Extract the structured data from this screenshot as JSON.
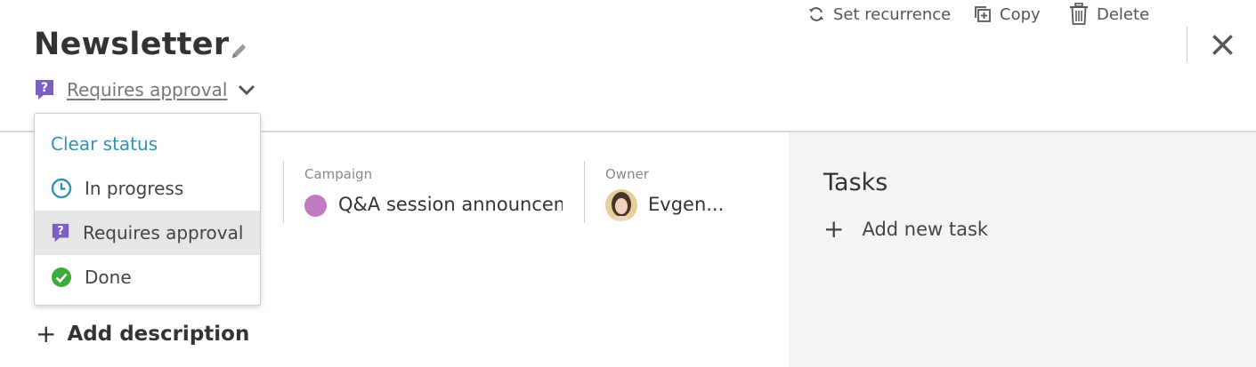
{
  "header": {
    "title": "Newsletter",
    "status": "Requires approval"
  },
  "toolbar": {
    "set_recurrence": "Set recurrence",
    "copy": "Copy",
    "delete": "Delete"
  },
  "fields": {
    "campaign_label": "Campaign",
    "campaign_value": "Q&A session announceme",
    "campaign_color": "#c07ac2",
    "owner_label": "Owner",
    "owner_value": "Evgen..."
  },
  "description": {
    "add_label": "Add description"
  },
  "tasks": {
    "title": "Tasks",
    "add_label": "Add new task"
  },
  "status_menu": {
    "clear": "Clear status",
    "items": [
      {
        "label": "In progress",
        "icon": "clock-icon"
      },
      {
        "label": "Requires approval",
        "icon": "question-bubble-icon",
        "selected": true
      },
      {
        "label": "Done",
        "icon": "check-circle-icon"
      }
    ]
  },
  "colors": {
    "accent_link": "#2f93b6",
    "approval_purple": "#7b5fc7",
    "done_green": "#3fa83f",
    "side_panel_bg": "#f4f4f4"
  }
}
